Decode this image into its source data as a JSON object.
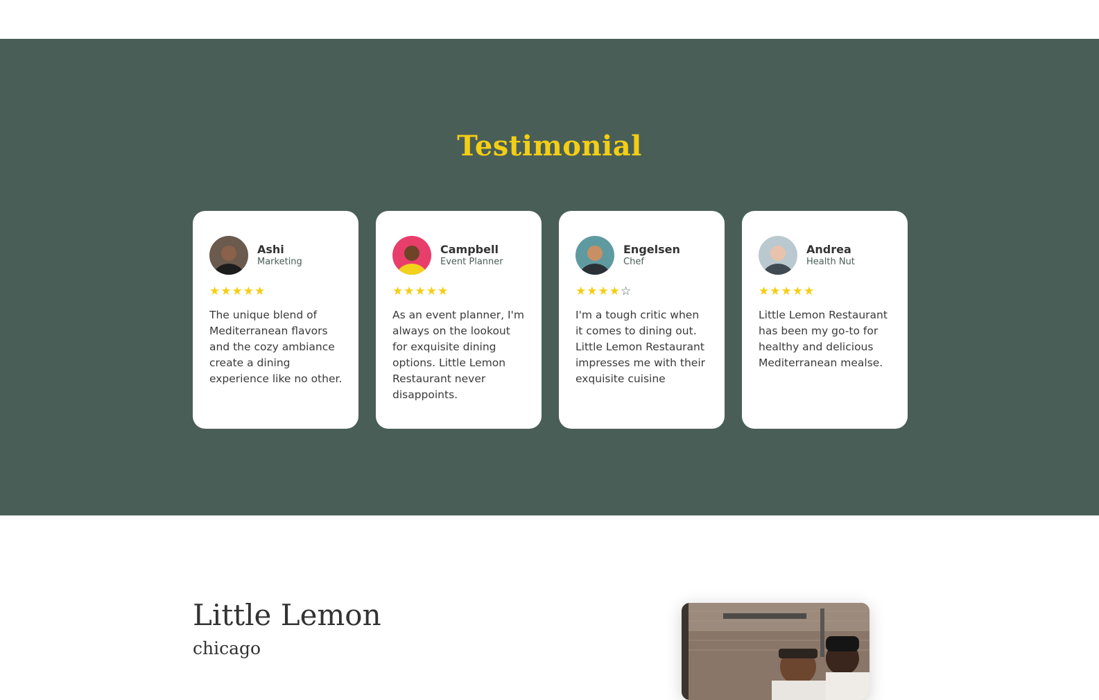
{
  "colors": {
    "green": "#495e57",
    "yellow": "#f4ce14",
    "dark": "#333333"
  },
  "testimonials": {
    "title": "Testimonial",
    "items": [
      {
        "name": "Ashi",
        "role": "Marketing",
        "rating": 5,
        "max": 5,
        "review": "The unique blend of Mediterranean flavors and the cozy ambiance create a dining experience like no other.",
        "avatar": "avatar-ashi",
        "bg": "#6b5a4e",
        "skin": "#8a6249",
        "cloth": "#1d1d1d"
      },
      {
        "name": "Campbell",
        "role": "Event Planner",
        "rating": 5,
        "max": 5,
        "review": "As an event planner, I'm always on the lookout for exquisite dining options. Little Lemon Restaurant never disappoints.",
        "avatar": "avatar-campbell",
        "bg": "#e83e6b",
        "skin": "#6e4328",
        "cloth": "#f2d21a"
      },
      {
        "name": "Engelsen",
        "role": "Chef",
        "rating": 4,
        "max": 5,
        "review": "I'm a tough critic when it comes to dining out. Little Lemon Restaurant impresses me with their exquisite cuisine",
        "avatar": "avatar-engelsen",
        "bg": "#5f9aa1",
        "skin": "#c98f64",
        "cloth": "#2b3036"
      },
      {
        "name": "Andrea",
        "role": "Health Nut",
        "rating": 5,
        "max": 5,
        "review": "Little Lemon Restaurant has been my go-to for healthy and delicious Mediterranean mealse.",
        "avatar": "avatar-andrea",
        "bg": "#b9c9cf",
        "skin": "#e9c2ad",
        "cloth": "#3f4a52"
      }
    ]
  },
  "about": {
    "title": "Little Lemon",
    "subtitle": "chicago"
  },
  "icons": {
    "star_full": "★",
    "star_empty": "☆"
  }
}
